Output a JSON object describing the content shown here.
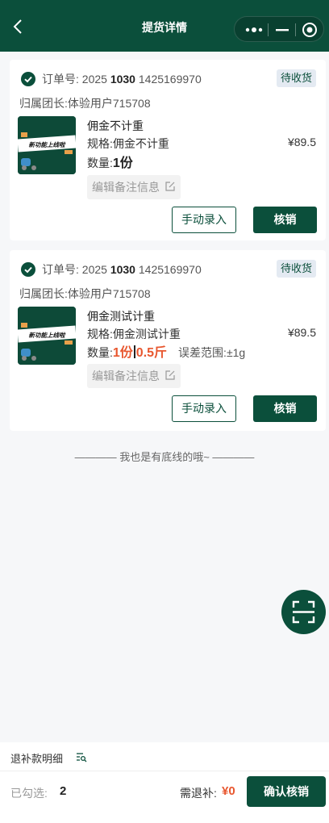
{
  "nav": {
    "title": "提货详情"
  },
  "orders": [
    {
      "order_label": "订单号:",
      "order_prefix": "2025",
      "order_bold": "1030",
      "order_suffix": "1425169970",
      "status": "待收货",
      "leader_label": "归属团长:",
      "leader_name": "体验用户715708",
      "thumb_text": "新功能上线啦",
      "product_name": "佣金不计重",
      "spec_label": "规格:",
      "spec_value": "佣金不计重",
      "price": "¥89.5",
      "qty_label": "数量:",
      "qty_value": "1份",
      "note_label": "编辑备注信息",
      "manual_button": "手动录入",
      "verify_button": "核销"
    },
    {
      "order_label": "订单号:",
      "order_prefix": "2025",
      "order_bold": "1030",
      "order_suffix": "1425169970",
      "status": "待收货",
      "leader_label": "归属团长:",
      "leader_name": "体验用户715708",
      "thumb_text": "新功能上线啦",
      "product_name": "佣金测试计重",
      "spec_label": "规格:",
      "spec_value": "佣金测试计重",
      "price": "¥89.5",
      "qty_label": "数量:",
      "qty_value": "1份",
      "weight_value": "0.5斤",
      "tolerance_label": "误差范围:",
      "tolerance_value": "±1g",
      "note_label": "编辑备注信息",
      "manual_button": "手动录入",
      "verify_button": "核销"
    }
  ],
  "end_text": "———— 我也是有底线的哦~ ————",
  "refund_detail_label": "退补款明细",
  "footer": {
    "selected_label": "已勾选:",
    "selected_count": "2",
    "refund_label": "需退补:",
    "refund_value": "¥0",
    "confirm_button": "确认核销"
  },
  "colors": {
    "brand": "#0b4f3b",
    "accent": "#e8572f",
    "status_bg": "#e4eaf2"
  },
  "icons": [
    "back-icon",
    "more-dots-icon",
    "minimize-icon",
    "close-target-icon",
    "check-icon",
    "edit-icon",
    "scan-icon",
    "list-search-icon"
  ]
}
